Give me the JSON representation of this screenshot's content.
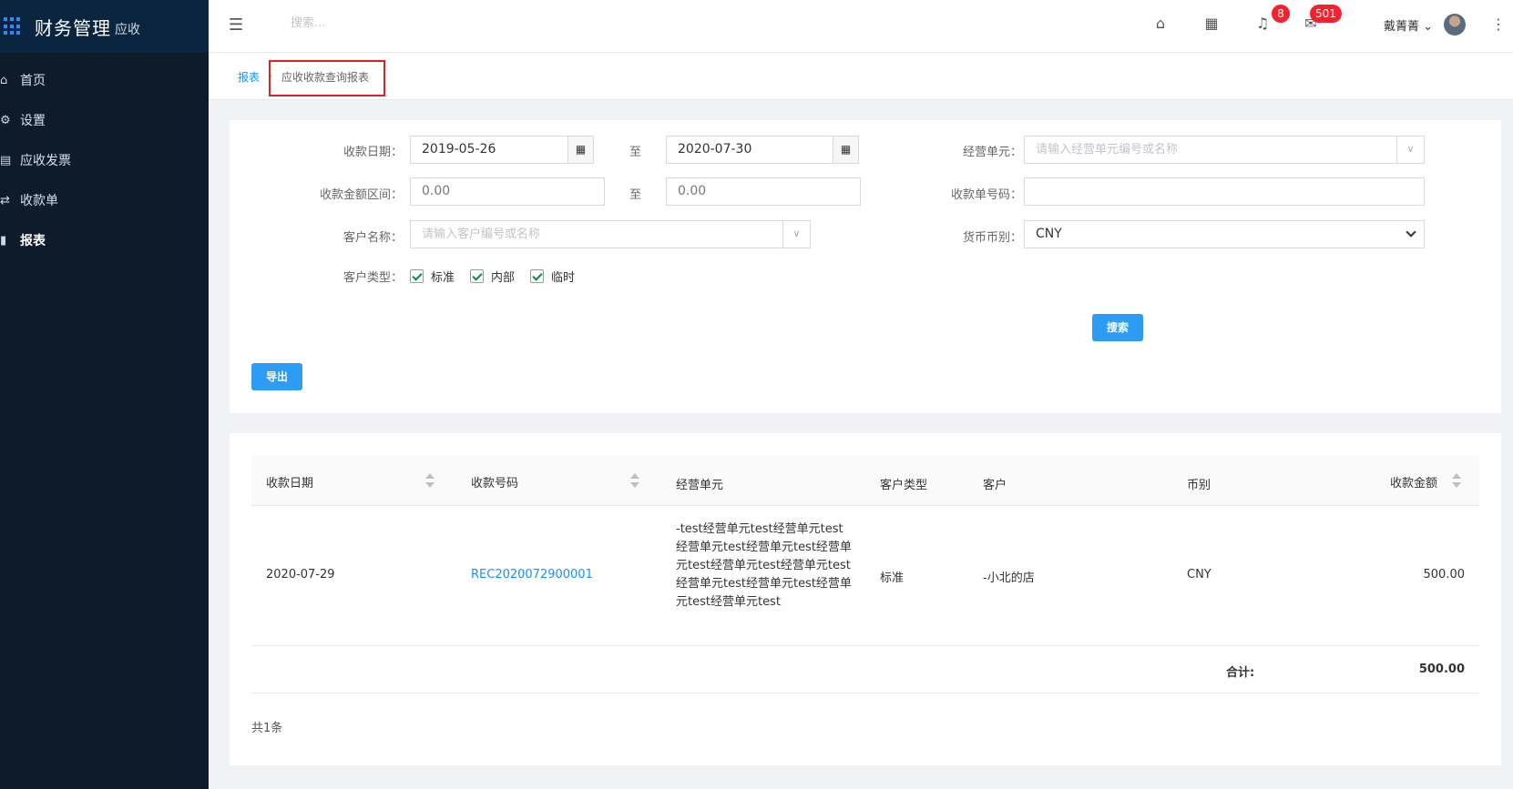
{
  "brand": {
    "title": "财务管理",
    "sub": "应收"
  },
  "sidebar": {
    "items": [
      {
        "label": "首页",
        "icon": "home-icon"
      },
      {
        "label": "设置",
        "icon": "gear-icon"
      },
      {
        "label": "应收发票",
        "icon": "invoice-icon"
      },
      {
        "label": "收款单",
        "icon": "receipt-icon"
      },
      {
        "label": "报表",
        "icon": "bar-chart-icon"
      }
    ]
  },
  "topbar": {
    "search_placeholder": "搜索...",
    "notifications_count": "8",
    "messages_count": "501",
    "user_name": "戴菁菁"
  },
  "breadcrumb": {
    "root": "报表",
    "sep": "›",
    "current": "应收收款查询报表"
  },
  "filter": {
    "date_label": "收款日期：",
    "date_from": "2019-05-26",
    "date_to": "2020-07-30",
    "to": "至",
    "amount_label": "收款金额区间：",
    "amount_from": "0.00",
    "amount_to": "0.00",
    "customer_label": "客户名称：",
    "customer_placeholder": "请输入客户编号或名称",
    "customer_type_label": "客户类型：",
    "customer_types": [
      "标准",
      "内部",
      "临时"
    ],
    "unit_label": "经营单元：",
    "unit_placeholder": "请输入经营单元编号或名称",
    "receipt_no_label": "收款单号码：",
    "receipt_no_value": "",
    "currency_label": "货币币别：",
    "currency_value": "CNY",
    "search_button": "搜索",
    "export_button": "导出"
  },
  "table": {
    "headers": [
      "收款日期",
      "收款号码",
      "经营单元",
      "客户类型",
      "客户",
      "币别",
      "收款金额"
    ],
    "rows": [
      {
        "date": "2020-07-29",
        "number": "REC2020072900001",
        "unit": "-test经营单元test经营单元test经营单元test经营单元test经营单元test经营单元test经营单元test经营单元test经营单元test经营单元test经营单元test",
        "customer_type": "标准",
        "customer": "-小北的店",
        "currency": "CNY",
        "amount": "500.00"
      }
    ],
    "sum_label": "合计:",
    "sum_value": "500.00",
    "total_count": "共1条"
  }
}
